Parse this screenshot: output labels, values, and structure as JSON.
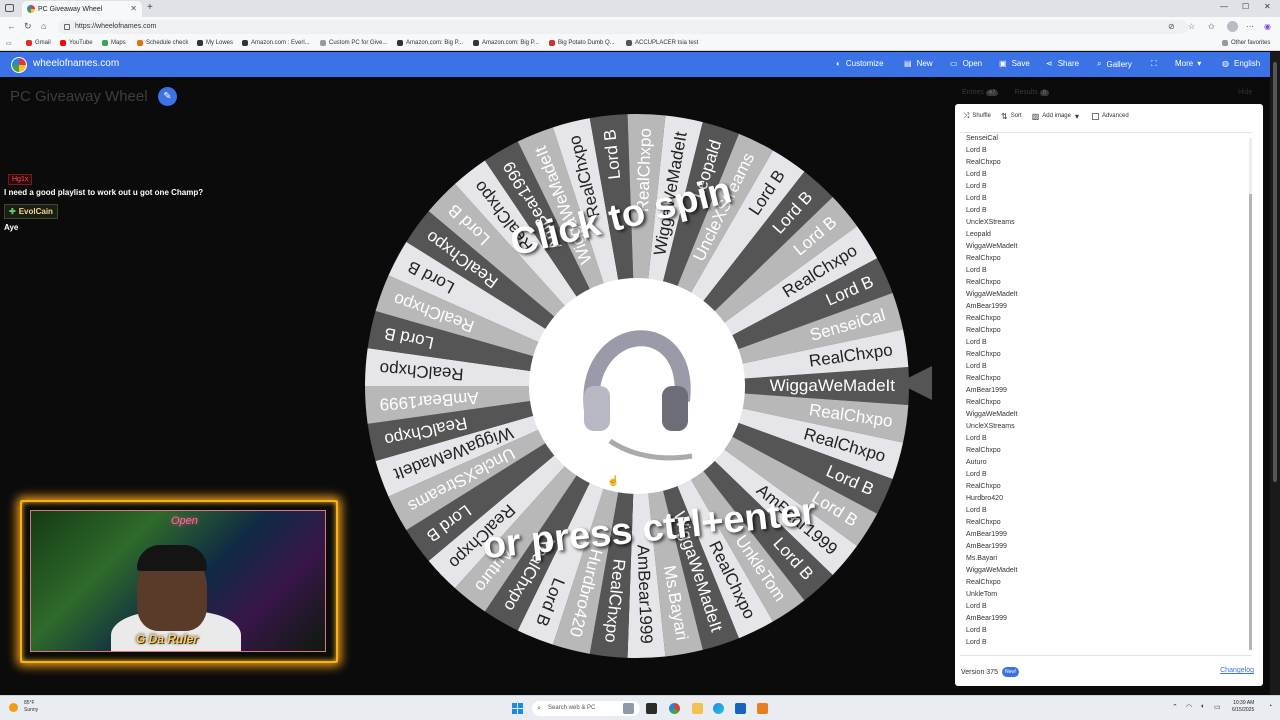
{
  "browser": {
    "tab_title": "PC Giveaway Wheel",
    "url": "https://wheelofnames.com",
    "bookmarks": [
      "Gmail",
      "YouTube",
      "Maps",
      "Schedule check",
      "My Lowes",
      "Amazon.com : Everl...",
      "Custom PC for Give...",
      "Amazon.com: Big P...",
      "Amazon.com: Big P...",
      "Big Potato Dumb Q...",
      "ACCUPLACER tsia test"
    ],
    "other_favorites": "Other favorites"
  },
  "app": {
    "brand": "wheelofnames.com",
    "menu": [
      "Customize",
      "New",
      "Open",
      "Save",
      "Share",
      "Gallery",
      "More",
      "English"
    ],
    "wheel_title": "PC Giveaway Wheel"
  },
  "chat": {
    "user1": "Hg1x",
    "msg1": "I need a good playlist to work out u got one Champ?",
    "user2": "EvolCain",
    "msg2": "Aye"
  },
  "stream": {
    "neon_sign": "Open",
    "overlay_name": "G Da Ruler"
  },
  "wheel": {
    "top_text": "Click to spin",
    "bottom_text": "or press ctrl+enter",
    "slices": [
      "WiggaWeMadeIt",
      "RealChxpo",
      "RealChxpo",
      "Lord B",
      "Lord B",
      "AmBear1999",
      "Lord B",
      "UnkleTom",
      "RealChxpo",
      "WiggaWeMadeIt",
      "Ms.Bayari",
      "AmBear1999",
      "RealChxpo",
      "Hurdbro420",
      "Lord B",
      "RealChxpo",
      "Auturo",
      "RealChxpo",
      "Lord B",
      "UncleXStreams",
      "WiggaWeMadeIt",
      "RealChxpo",
      "AmBear1999",
      "RealChxpo",
      "Lord B",
      "RealChxpo",
      "Lord B",
      "RealChxpo",
      "Lord B",
      "RealChxpo",
      "AmBear1999",
      "WiggaWeMadeIt",
      "RealChxpo",
      "Lord B",
      "RealChxpo",
      "WiggaWeMadeIt",
      "Leopald",
      "UncleXStreams",
      "Lord B",
      "Lord B",
      "Lord B",
      "RealChxpo",
      "Lord B",
      "SenseiCal",
      "RealChxpo"
    ]
  },
  "panel": {
    "entries_tab": "Entries",
    "entries_count": "47",
    "results_tab": "Results",
    "results_count": "0",
    "hide": "Hide",
    "toolbar": {
      "shuffle": "Shuffle",
      "sort": "Sort",
      "add_image": "Add image",
      "advanced": "Advanced"
    },
    "entries": [
      "SenseiCal",
      "Lord B",
      "RealChxpo",
      "Lord B",
      "Lord B",
      "Lord B",
      "Lord B",
      "UncleXStreams",
      "Leopald",
      "WiggaWeMadeIt",
      "RealChxpo",
      "Lord B",
      "RealChxpo",
      "WiggaWeMadeIt",
      "AmBear1999",
      "RealChxpo",
      "RealChxpo",
      "Lord B",
      "RealChxpo",
      "Lord B",
      "RealChxpo",
      "AmBear1999",
      "RealChxpo",
      "WiggaWeMadeIt",
      "UncleXStreams",
      "Lord B",
      "RealChxpo",
      "Auturo",
      "Lord B",
      "RealChxpo",
      "Hurdbro420",
      "Lord B",
      "RealChxpo",
      "AmBear1999",
      "AmBear1999",
      "Ms.Bayari",
      "WiggaWeMadeIt",
      "RealChxpo",
      "UnkleTom",
      "Lord B",
      "AmBear1999",
      "Lord B",
      "Lord B"
    ],
    "version": "Version 375",
    "new_badge": "New!",
    "changelog": "Changelog"
  },
  "taskbar": {
    "weather_temp": "85°F",
    "weather_desc": "Sunny",
    "search_placeholder": "Search web & PC",
    "time": "10:39 AM",
    "date": "6/15/2025"
  },
  "colors": {
    "accent": "#3b73e6",
    "slice_dark": "#555555",
    "slice_light": "#b8b8b8",
    "slice_white": "#e6e6ea"
  }
}
